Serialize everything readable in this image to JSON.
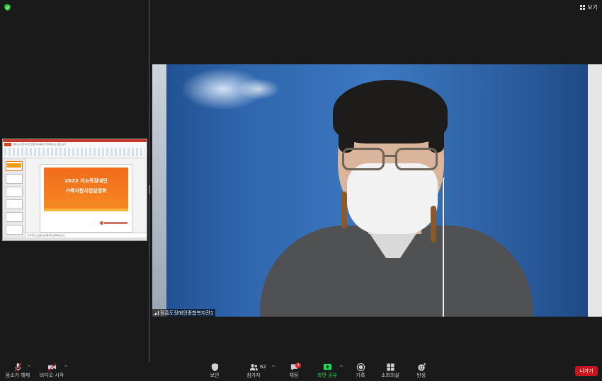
{
  "top": {
    "view_label": "보기"
  },
  "shared_screen": {
    "ribbon_tabs": "파일  홈  삽입  디자인  전환  애니메이션  슬라이드 쇼  검토  보기",
    "slide_title_line1": "2022 저소득장애인",
    "slide_title_line2": "가족지원사업설명회",
    "notes_text": "슬라이드 노트를 입력하려면 클릭하십시오.",
    "accent_color": "#f26b1d"
  },
  "video": {
    "participant_name": "장흥도장애인종합복지관1"
  },
  "toolbar": {
    "mute_label": "음소거 해제",
    "video_label": "비디오 시작",
    "security_label": "보안",
    "participants_label": "참가자",
    "participants_count": "62",
    "chat_label": "채팅",
    "chat_badge": "4",
    "share_label": "화면 공유",
    "record_label": "기록",
    "breakout_label": "소회의실",
    "reactions_label": "반응",
    "leave_label": "나가기",
    "share_color": "#23d959",
    "leave_color": "#c5151f"
  }
}
